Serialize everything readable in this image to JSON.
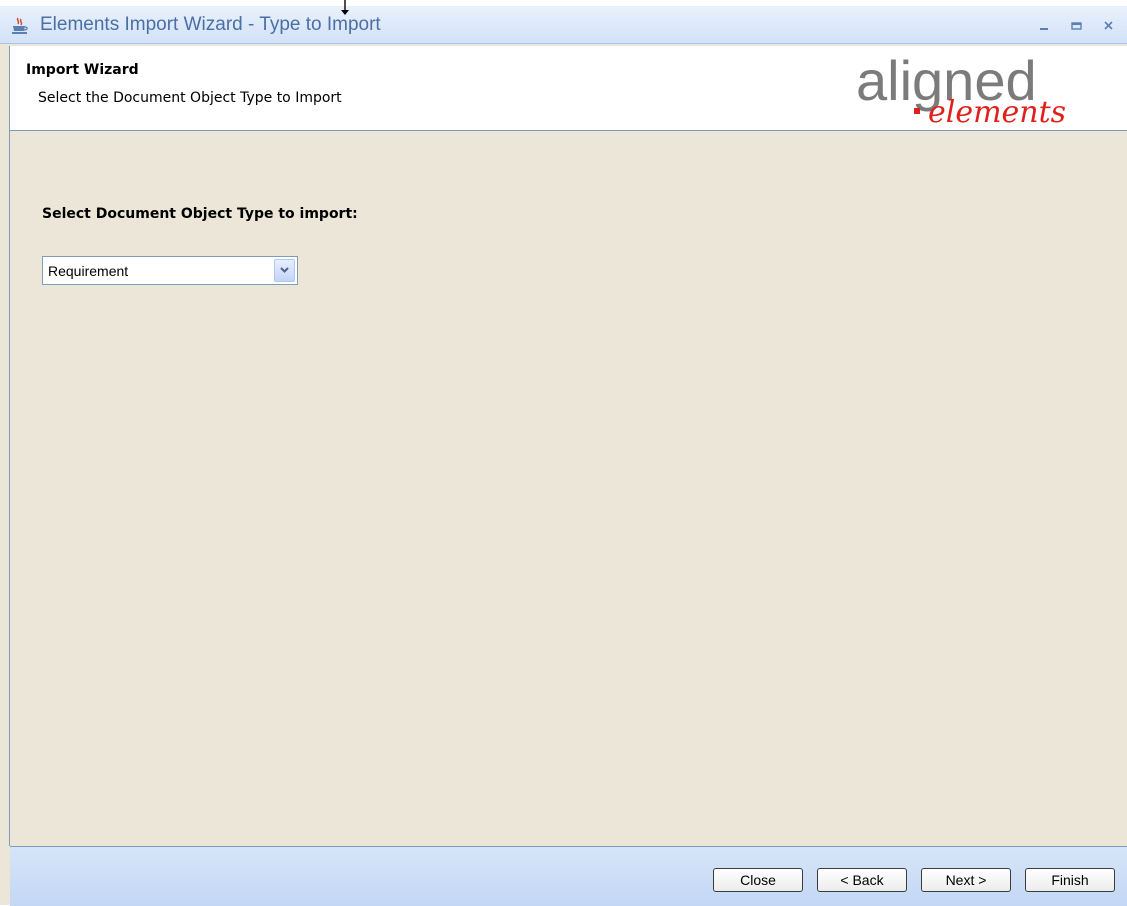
{
  "window": {
    "title": "Elements Import Wizard - Type to Import",
    "controls": [
      "minimize-icon",
      "maximize-icon",
      "close-icon"
    ]
  },
  "header": {
    "title": "Import Wizard",
    "subtitle": "Select the Document Object Type to Import",
    "logo": {
      "word1": "aligned",
      "word2": "elements"
    }
  },
  "main": {
    "prompt_label": "Select Document Object Type to import:",
    "object_type_select": {
      "selected": "Requirement"
    }
  },
  "footer": {
    "close_label": "Close",
    "back_label": "< Back",
    "next_label": "Next >",
    "finish_label": "Finish"
  },
  "colors": {
    "title_text": "#4a6fa5",
    "body_background": "#ebe6d8",
    "footer_background": "#c9dcf5",
    "logo_gray": "#7b7b7b",
    "logo_red": "#e0201b"
  }
}
